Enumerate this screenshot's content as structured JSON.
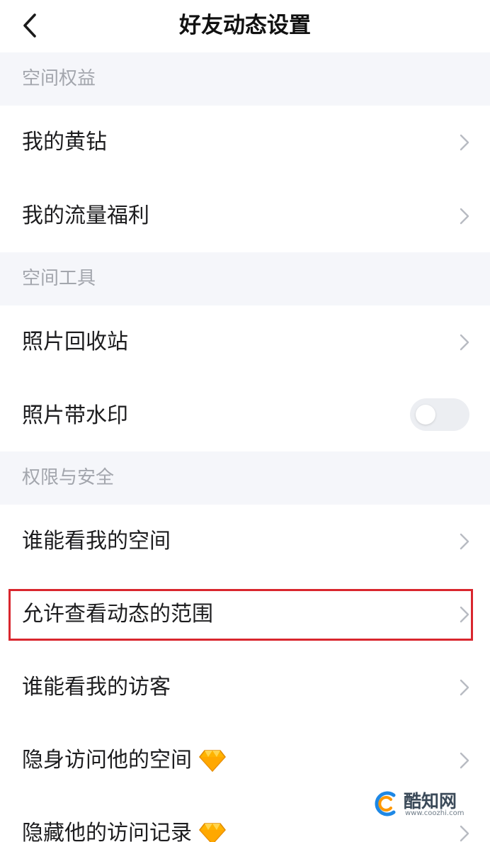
{
  "header": {
    "title": "好友动态设置",
    "back_icon": "chevron-left-icon"
  },
  "sections": [
    {
      "title": "空间权益",
      "items": [
        {
          "label": "我的黄钻"
        },
        {
          "label": "我的流量福利"
        }
      ]
    },
    {
      "title": "空间工具",
      "items": [
        {
          "label": "照片回收站"
        },
        {
          "label": "照片带水印",
          "toggle": false
        }
      ]
    },
    {
      "title": "权限与安全",
      "items": [
        {
          "label": "谁能看我的空间"
        },
        {
          "label": "允许查看动态的范围",
          "highlighted": true
        },
        {
          "label": "谁能看我的访客"
        },
        {
          "label": "隐身访问他的空间",
          "badge_icon": "diamond-icon"
        },
        {
          "label": "隐藏他的访问记录",
          "badge_icon": "diamond-icon"
        }
      ]
    }
  ],
  "watermark": {
    "name": "酷知网",
    "url": "www.coozhi.com"
  },
  "colors": {
    "highlight_border": "#d9262e",
    "section_bg": "#f5f6fa",
    "section_text": "#a3a6ad",
    "chevron": "#b8bbc2"
  }
}
